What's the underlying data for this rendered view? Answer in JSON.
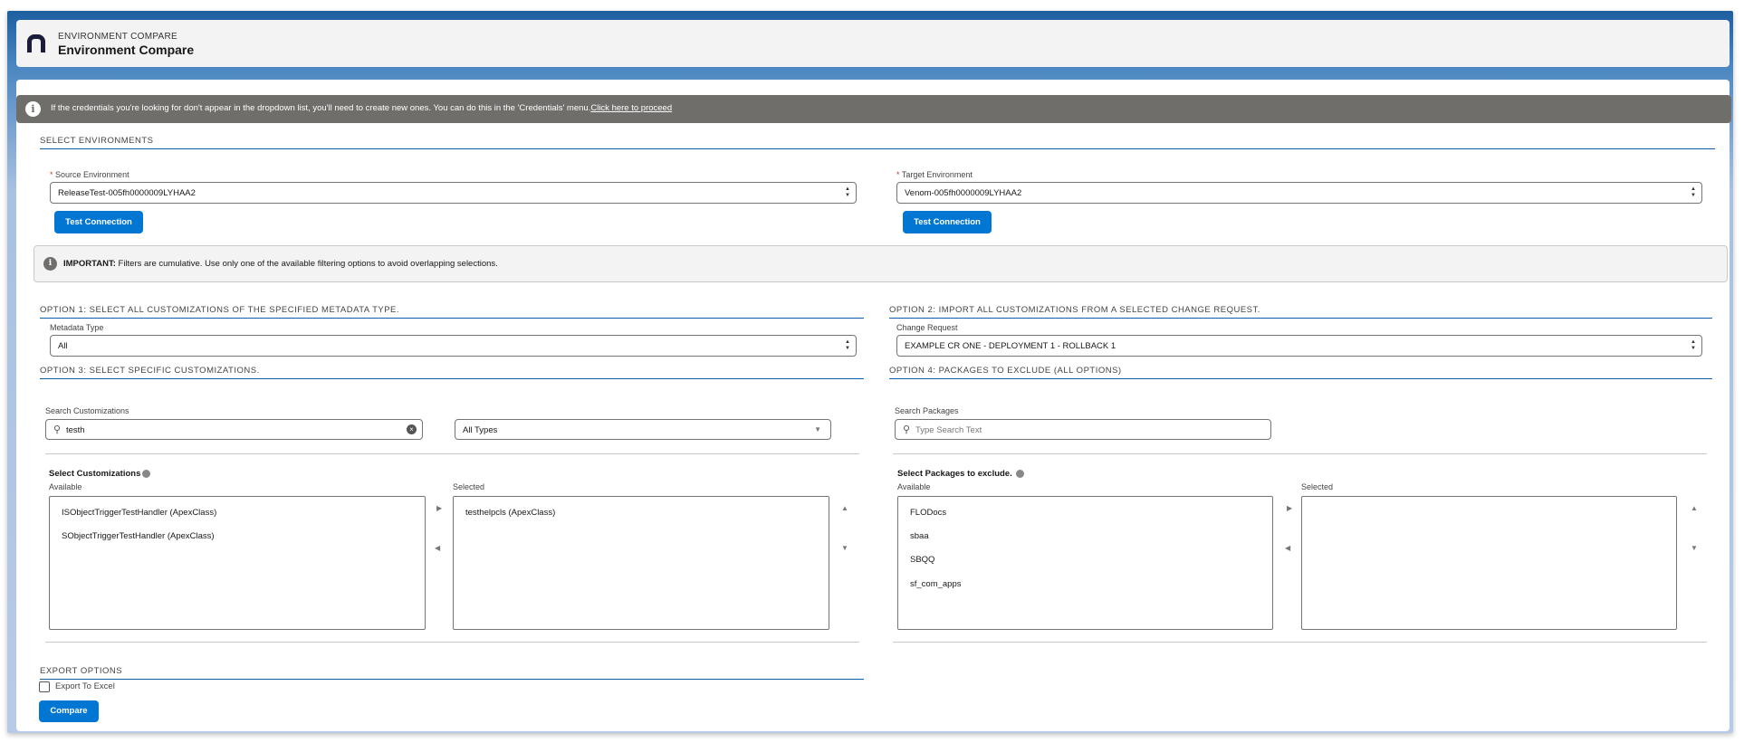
{
  "header": {
    "eyebrow": "ENVIRONMENT COMPARE",
    "title": "Environment Compare"
  },
  "banner": {
    "text": "If the credentials you're looking for don't appear in the dropdown list, you'll need to create new ones. You can do this in the 'Credentials' menu.",
    "link": "Click here to proceed"
  },
  "environments": {
    "section": "SELECT ENVIRONMENTS",
    "source_label": "Source Environment",
    "source_value": "ReleaseTest-005fh0000009LYHAA2",
    "target_label": "Target Environment",
    "target_value": "Venom-005fh0000009LYHAA2",
    "test_connection": "Test Connection",
    "required": "*"
  },
  "important": {
    "strong": "IMPORTANT:",
    "text": " Filters are cumulative. Use only one of the available filtering options to avoid overlapping selections."
  },
  "option1": {
    "title": "OPTION 1: SELECT ALL CUSTOMIZATIONS OF THE SPECIFIED METADATA TYPE.",
    "label": "Metadata Type",
    "value": "All"
  },
  "option2": {
    "title": "OPTION 2: IMPORT ALL CUSTOMIZATIONS FROM A SELECTED CHANGE REQUEST.",
    "label": "Change Request",
    "value": "EXAMPLE CR ONE - DEPLOYMENT 1 - ROLLBACK 1"
  },
  "option3": {
    "title": "OPTION 3: SELECT SPECIFIC CUSTOMIZATIONS.",
    "search_label": "Search Customizations",
    "search_value": "testh",
    "type_filter": "All Types",
    "list_title": "Select Customizations",
    "available_label": "Available",
    "selected_label": "Selected",
    "available": [
      "ISObjectTriggerTestHandler (ApexClass)",
      "SObjectTriggerTestHandler (ApexClass)"
    ],
    "selected": [
      "testhelpcls (ApexClass)"
    ]
  },
  "option4": {
    "title": "OPTION 4: PACKAGES TO EXCLUDE (ALL OPTIONS)",
    "search_label": "Search Packages",
    "search_placeholder": "Type Search Text",
    "list_title": "Select Packages to exclude.",
    "available_label": "Available",
    "selected_label": "Selected",
    "available": [
      "FLODocs",
      "sbaa",
      "SBQQ",
      "sf_com_apps"
    ],
    "selected": []
  },
  "export": {
    "title": "EXPORT OPTIONS",
    "checkbox_label": "Export To Excel",
    "checked": false,
    "compare": "Compare"
  }
}
